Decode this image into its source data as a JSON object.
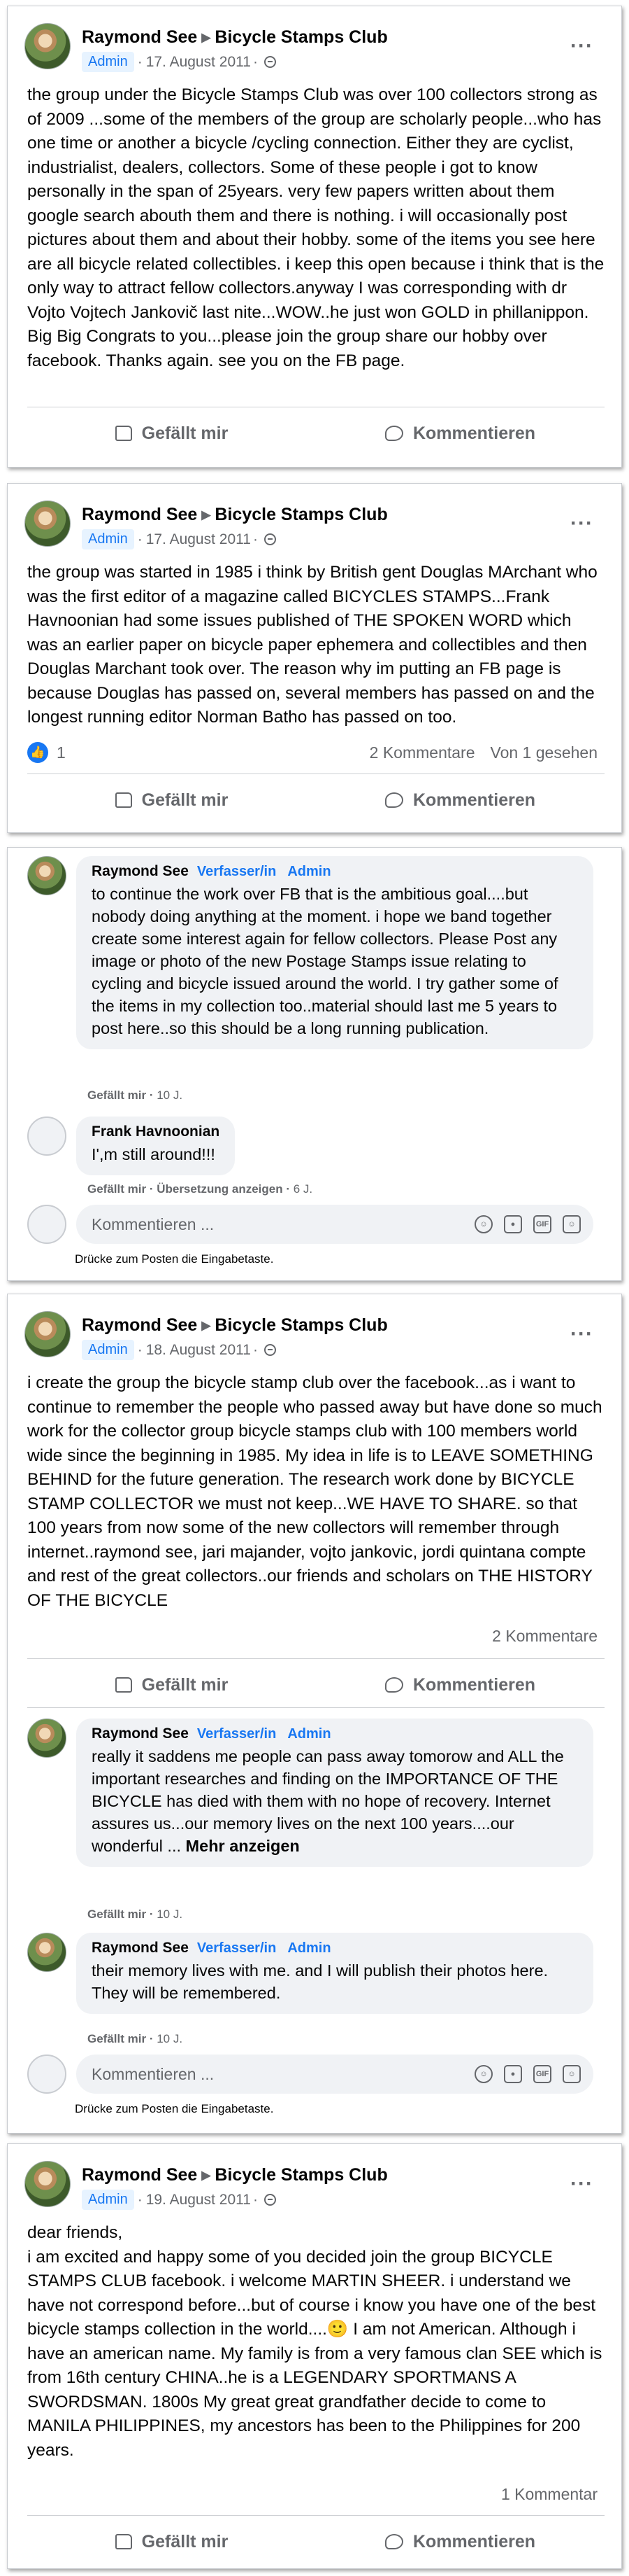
{
  "colors": {
    "accent": "#1877f2",
    "badge_bg": "#e7f3ff",
    "bubble_bg": "#f0f2f5",
    "muted": "#65676b"
  },
  "icons": [
    "globe-icon",
    "more-options-icon",
    "like-icon",
    "comment-icon",
    "emoji-icon",
    "camera-icon",
    "gif-icon",
    "sticker-icon"
  ],
  "labels": {
    "like": "Gefällt mir",
    "comment": "Kommentieren",
    "comment_placeholder": "Kommentieren ...",
    "enter_hint": "Drücke zum Posten die Eingabetaste.",
    "author_role": "Verfasser/in",
    "admin": "Admin",
    "translate": "Übersetzung anzeigen",
    "see_more": "Mehr anzeigen",
    "gif": "GIF"
  },
  "posts": [
    {
      "author": "Raymond See",
      "group": "Bicycle Stamps Club",
      "badge": "Admin",
      "date": "17. August 2011",
      "text": "the group under the Bicycle Stamps Club was over 100 collectors strong as of 2009 ...some of the members of the group are scholarly people...who has one time or another a bicycle /cycling connection. Either they are cyclist, industrialist, dealers, collectors. Some of these people i got to know personally in the span of 25years. very few papers written about them google search abouth them and there is nothing. i will occasionally post pictures about them and about their hobby. some of the items you see here are all bicycle related collectibles. i keep this open because i think that is the only way to attract fellow collectors.anyway I was corresponding with dr Vojto Vojtech Jankovič last nite...WOW..he just won GOLD in phillanippon. Big Big Congrats to you...please join the group share our hobby over facebook. Thanks again. see you on the FB page."
    },
    {
      "author": "Raymond See",
      "group": "Bicycle Stamps Club",
      "badge": "Admin",
      "date": "17. August 2011",
      "text": "the group was started in 1985 i think by British gent Douglas MArchant who was the first editor of a magazine called BICYCLES STAMPS...Frank Havnoonian had some issues published of THE SPOKEN WORD  which was an earlier paper on bicycle paper ephemera and collectibles and then Douglas Marchant took over. The reason why im putting an FB page is because Douglas has passed on, several members has passed on and the longest running editor Norman Batho has passed on too.",
      "like_count": "1",
      "comment_count": "2 Kommentare",
      "seen": "Von 1 gesehen"
    },
    {
      "author": "Raymond See",
      "group": "Bicycle Stamps Club",
      "badge": "Admin",
      "date": "18. August 2011",
      "text": "i create the group the bicycle stamp club over the facebook...as i want to continue to remember the people who passed away but have done so much work for the collector group bicycle stamps club with 100 members world wide since the beginning in 1985. My idea in life is to LEAVE SOMETHING BEHIND for the future generation. The research work done by BICYCLE STAMP COLLECTOR we must not keep...WE HAVE TO SHARE. so that 100 years from now some of the new collectors will remember through internet..raymond see, jari majander, vojto jankovic, jordi quintana compte and rest of the great collectors..our friends and  scholars on THE HISTORY OF THE BICYCLE",
      "comment_count": "2 Kommentare"
    },
    {
      "author": "Raymond See",
      "group": "Bicycle Stamps Club",
      "badge": "Admin",
      "date": "19. August 2011",
      "text": "dear friends,\ni am excited and happy some of you decided join the group BICYCLE STAMPS CLUB facebook. i welcome MARTIN SHEER. i understand we have not correspond before...but of course  i know you have one of the best bicycle stamps collection in the world....🙂    I am not American. Although i have an american name. My family is from a very famous clan SEE which is from 16th century CHINA..he is a LEGENDARY SPORTMANS  A SWORDSMAN.  1800s My great great grandfather decide to come to MANILA PHILIPPINES, my ancestors has been to the Philippines for 200 years.",
      "comment_count": "1 Kommentar"
    }
  ],
  "thread_1": {
    "comment_1": {
      "author": "Raymond See",
      "text": "to continue the work over FB that is the ambitious goal....but nobody doing anything at the moment. i hope we band together create some interest again for fellow collectors. Please Post any image or photo of the new Postage Stamps issue relating to cycling and bicycle issued around the world. I try gather some of the items in my collection too..material should last me 5 years to post here..so this should be a long running publication.",
      "age": "10 J."
    },
    "comment_2": {
      "author": "Frank Havnoonian",
      "text": "I',m still around!!!",
      "age": "6 J."
    }
  },
  "thread_2": {
    "comment_1": {
      "author": "Raymond See",
      "text": "really it saddens me people can pass away tomorow and ALL the important researches and finding on the IMPORTANCE OF THE BICYCLE has died with them with no hope of recovery. Internet assures us...our memory lives on the next 100 years....our wonderful ...",
      "age": "10 J."
    },
    "comment_2": {
      "author": "Raymond See",
      "text": "their memory lives with me. and I will publish their photos here. They will be remembered.",
      "age": "10 J."
    }
  }
}
